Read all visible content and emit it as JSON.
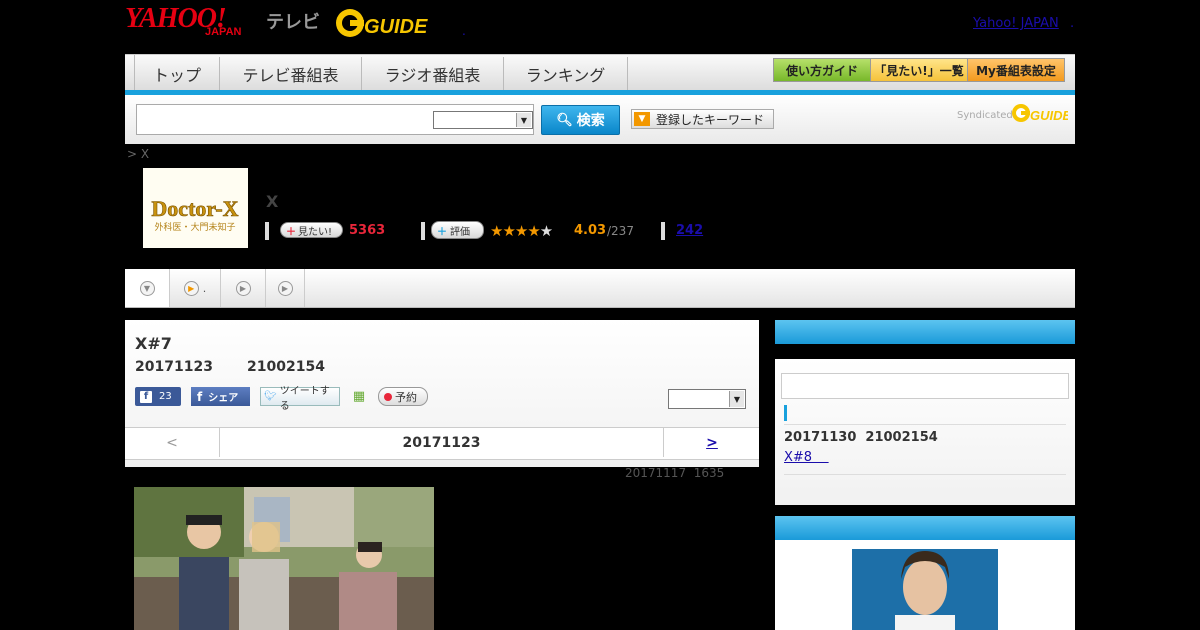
{
  "header": {
    "logo_yahoo": "YAHOO!",
    "logo_japan": "JAPAN",
    "logo_tv": "テレビ",
    "logo_gguide": "GUIDE",
    "yahoo_japan_link": "Yahoo! JAPAN",
    "dot_right": ".",
    "dot_mid": "."
  },
  "nav": {
    "tabs": [
      "トップ",
      "テレビ番組表",
      "ラジオ番組表",
      "ランキング"
    ],
    "buttons": [
      "使い方ガイド",
      "「見たい!」一覧",
      "My番組表設定"
    ]
  },
  "search": {
    "button_label": "検索",
    "keyword_button": "登録したキーワード",
    "syndicated": "Syndicated",
    "syndicated_logo": "GUIDE"
  },
  "breadcrumb": "> X",
  "program": {
    "thumb_title": "Doctor-X",
    "thumb_subtitle": "外科医・大門未知子",
    "title": "X",
    "mitai_label": "見たい!",
    "mitai_count": "5363",
    "rate_label": "評価",
    "stars": "★★★★★",
    "score": "4.03",
    "score_of": "/237",
    "review_count": "242"
  },
  "subtabs": {
    "tab2_text": "."
  },
  "episode": {
    "title": "X#7",
    "datetime": "20171123       21002154",
    "fb_count": "23",
    "share_label": "シェア",
    "tweet_label": "ツイートする",
    "reserve_label": "予約",
    "prev": "<",
    "current_date": "20171123",
    "next": ">",
    "updated": "20171117  1635"
  },
  "sidebar": {
    "next_datetime": "20171130  21002154",
    "next_link": "X#8    "
  },
  "colors": {
    "accent_blue": "#19a1dd",
    "nav_green": "#8dc63f",
    "nav_orange": "#f5a623",
    "star_orange": "#f39800",
    "count_red": "#e8263a"
  }
}
